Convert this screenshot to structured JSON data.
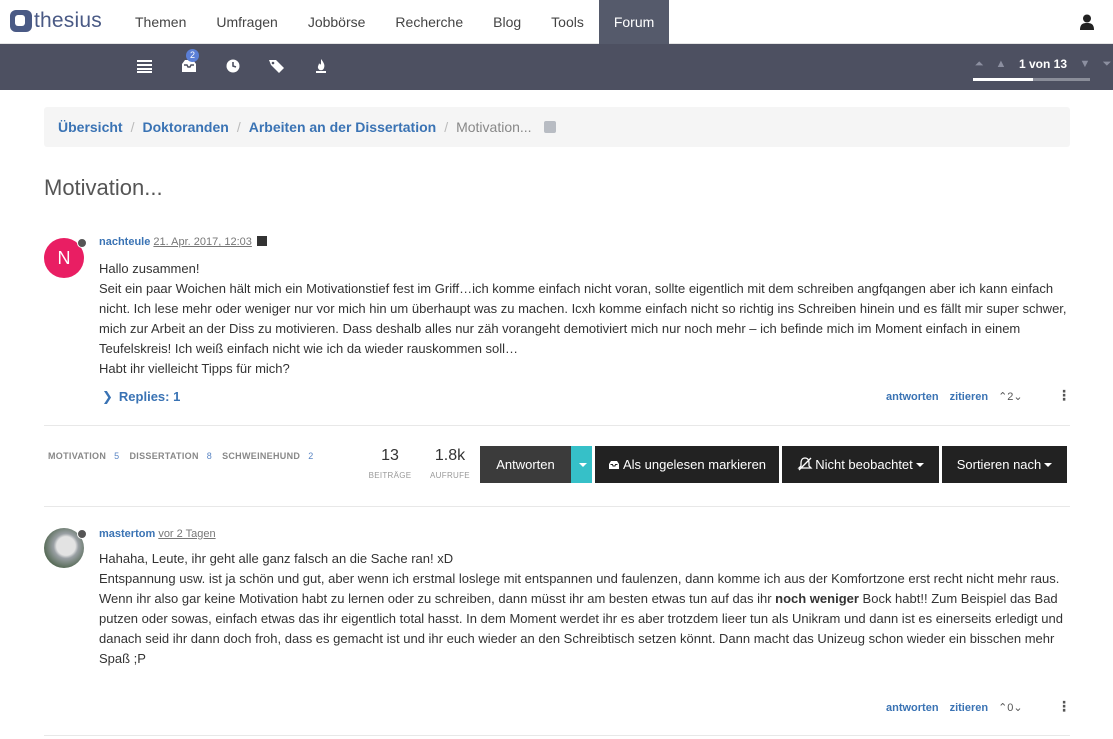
{
  "topnav": {
    "logo": "thesius",
    "menu": [
      "Themen",
      "Umfragen",
      "Jobbörse",
      "Recherche",
      "Blog",
      "Tools",
      "Forum"
    ],
    "active": "Forum"
  },
  "subbar": {
    "icons": [
      "list-icon",
      "inbox-icon",
      "clock-icon",
      "tags-icon",
      "fire-icon"
    ],
    "inbox_badge": "2",
    "pagination": "1 von 13",
    "progress": 0.08
  },
  "breadcrumb": [
    "Übersicht",
    "Doktoranden",
    "Arbeiten an der Dissertation",
    "Motivation..."
  ],
  "title": "Motivation...",
  "posts": [
    {
      "author": "nachteule",
      "avatar_letter": "N",
      "time": "21. Apr. 2017, 12:03",
      "body": [
        "Hallo zusammen!",
        "Seit ein paar Woichen hält mich ein Motivationstief fest im Griff…ich komme einfach nicht voran, sollte eigentlich mit dem schreiben angfqangen aber ich kann einfach nicht. Ich lese mehr oder weniger nur vor mich hin um überhaupt was zu machen. Icxh komme einfach nicht so richtig ins Schreiben hinein und es fällt mir super schwer, mich zur Arbeit an der Diss zu motivieren. Dass deshalb alles nur zäh vorangeht demotiviert mich nur noch mehr – ich befinde mich im Moment einfach in einem Teufelskreis! Ich weiß einfach nicht wie ich da wieder rauskommen soll…",
        "Habt ihr vielleicht Tipps für mich?"
      ],
      "replies": "Replies: 1",
      "reply_label": "antworten",
      "quote_label": "zitieren",
      "votes": "2"
    },
    {
      "author": "mastertom",
      "time": "vor 2 Tagen",
      "body": [
        "Hahaha, Leute, ihr geht alle ganz falsch an die Sache ran! xD",
        "Entspannung usw. ist ja schön und gut, aber wenn ich erstmal loslege mit entspannen und faulenzen, dann komme ich aus der Komfortzone erst recht nicht mehr raus."
      ],
      "body_p3_before": "Wenn ihr also gar keine Motivation habt zu lernen oder zu schreiben, dann müsst ihr am besten etwas tun auf das ihr ",
      "body_p3_bold": "noch weniger",
      "body_p3_after": " Bock habt!! Zum Beispiel das Bad putzen oder sowas, einfach etwas das ihr eigentlich total hasst. In dem Moment werdet ihr es aber trotzdem lieer tun als Unikram und dann ist es einerseits erledigt und danach seid ihr dann doch froh, dass es gemacht ist und ihr euch wieder an den Schreibtisch setzen könnt. Dann macht das Unizeug schon wieder ein bisschen mehr Spaß ;P",
      "reply_label": "antworten",
      "quote_label": "zitieren",
      "votes": "0"
    }
  ],
  "topic": {
    "tags": [
      {
        "name": "MOTIVATION",
        "count": "5"
      },
      {
        "name": "DISSERTATION",
        "count": "8"
      },
      {
        "name": "SCHWEINEHUND",
        "count": "2"
      }
    ],
    "posts_count": "13",
    "posts_label": "BEITRÄGE",
    "views_count": "1.8k",
    "views_label": "AUFRUFE",
    "buttons": {
      "reply": "Antworten",
      "mark_unread": "Als ungelesen markieren",
      "watch": "Nicht beobachtet",
      "sort": "Sortieren nach"
    },
    "accent": "#36c0c8"
  }
}
